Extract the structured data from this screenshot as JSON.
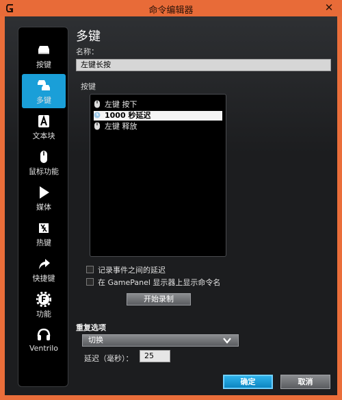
{
  "window": {
    "title": "命令编辑器",
    "close_glyph": "✕"
  },
  "sidebar": {
    "items": [
      {
        "label": "按键",
        "icon": "key-icon"
      },
      {
        "label": "多键",
        "icon": "multikey-icon",
        "active": true
      },
      {
        "label": "文本块",
        "icon": "text-block-icon"
      },
      {
        "label": "鼠标功能",
        "icon": "mouse-icon"
      },
      {
        "label": "媒体",
        "icon": "play-icon"
      },
      {
        "label": "热键",
        "icon": "hotkey-icon"
      },
      {
        "label": "快捷键",
        "icon": "shortcut-arrow-icon"
      },
      {
        "label": "功能",
        "icon": "function-gear-icon"
      },
      {
        "label": "Ventrilo",
        "icon": "headset-icon"
      }
    ]
  },
  "editor": {
    "heading": "多键",
    "name_label": "名称：",
    "name_value": "左键长按",
    "keys_label": "按键",
    "events": [
      {
        "text": "左键 按下",
        "icon": "mouse-icon"
      },
      {
        "text": "1000 秒延迟",
        "icon": "clock-icon",
        "selected": true
      },
      {
        "text": "左键 释放",
        "icon": "mouse-icon"
      }
    ],
    "record_delays_label": "记录事件之间的延迟",
    "show_gamepanel_label": "在 GamePanel 显示器上显示命令名",
    "record_button": "开始录制",
    "repeat_label": "重复选项",
    "repeat_value": "切换",
    "delay_label": "延迟（毫秒）：",
    "delay_value": "25",
    "ok_button": "确定",
    "cancel_button": "取消"
  },
  "colors": {
    "accent": "#1a9fd8",
    "titlebar": "#e86b38"
  }
}
